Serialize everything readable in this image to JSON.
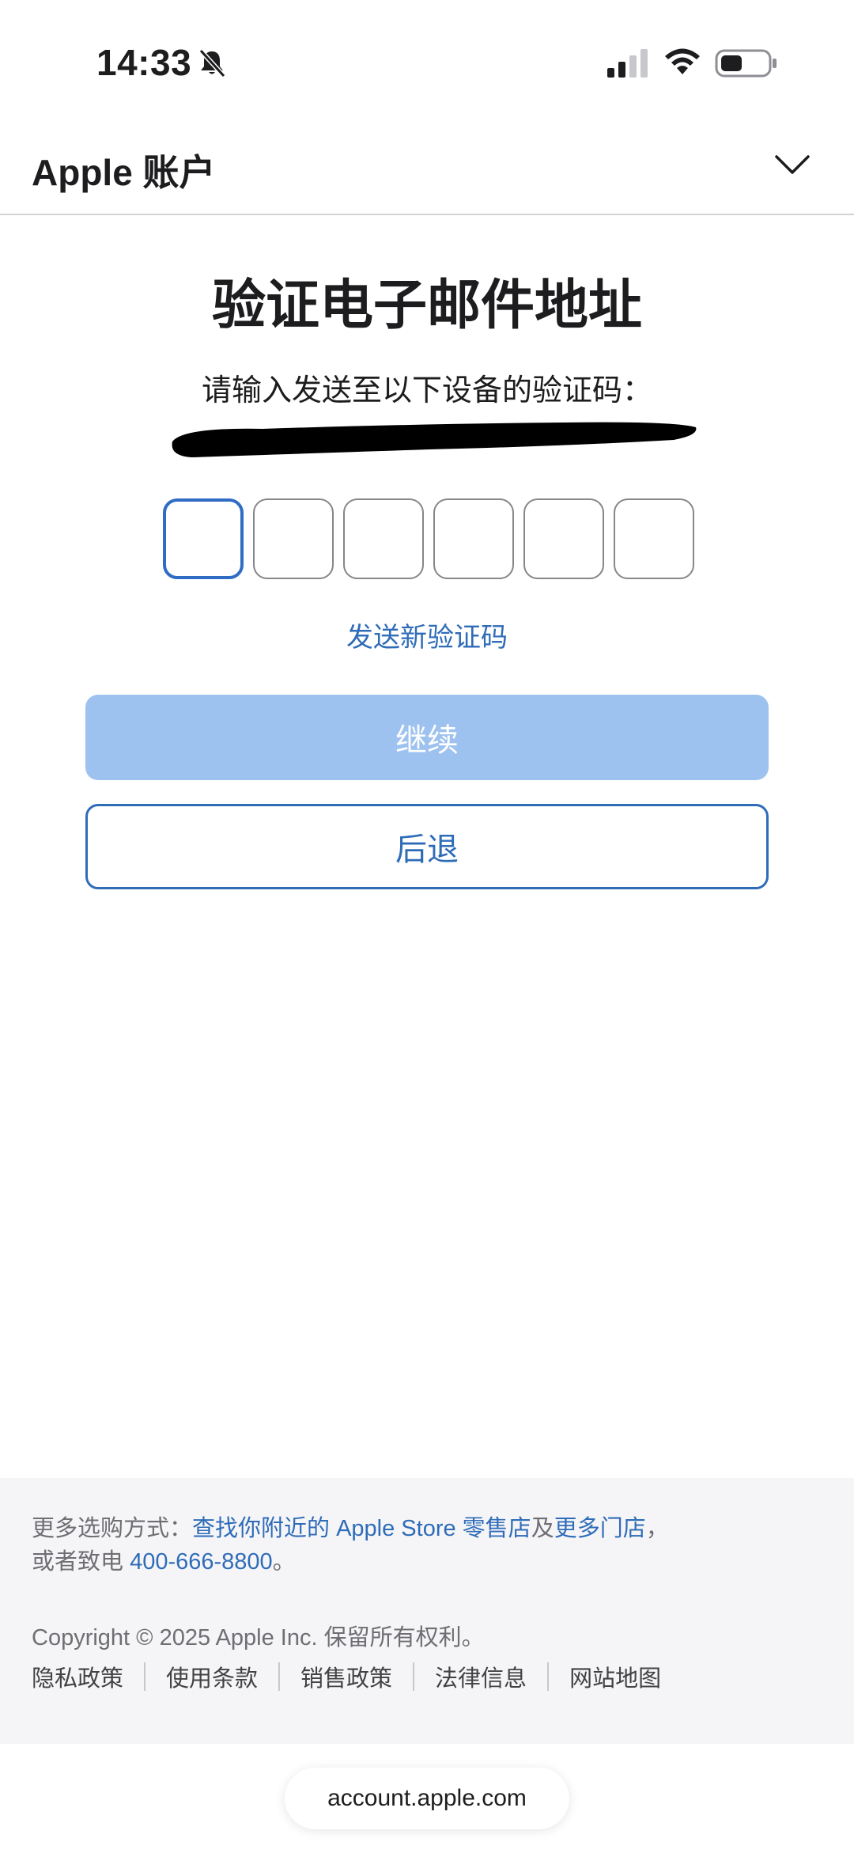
{
  "status_bar": {
    "time": "14:33"
  },
  "header": {
    "title": "Apple 账户"
  },
  "main": {
    "title": "验证电子邮件地址",
    "instruction": "请输入发送至以下设备的验证码：",
    "code_digits": [
      "",
      "",
      "",
      "",
      "",
      ""
    ],
    "resend_link": "发送新验证码",
    "continue_label": "继续",
    "back_label": "后退"
  },
  "footer": {
    "shop_prefix": "更多选购方式：",
    "find_store_link": "查找你附近的 Apple Store 零售店",
    "and_text": "及",
    "more_stores_link": "更多门店",
    "comma": "，",
    "call_prefix": "或者致电 ",
    "phone": "400-666-8800",
    "period": "。",
    "copyright": "Copyright © 2025 Apple Inc. 保留所有权利。",
    "links": [
      "隐私政策",
      "使用条款",
      "销售政策",
      "法律信息",
      "网站地图"
    ]
  },
  "browser": {
    "url": "account.apple.com"
  },
  "colors": {
    "accent": "#2f6cb8",
    "continue_disabled": "#9ec2ef",
    "footer_bg": "#f5f5f7",
    "active_input_border": "#2f6cc4"
  }
}
